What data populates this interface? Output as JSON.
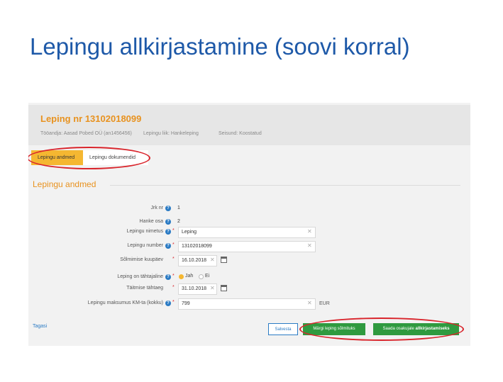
{
  "slide": {
    "title": "Lepingu allkirjastamine (soovi korral)"
  },
  "header": {
    "contract_title": "Leping nr 13102018099",
    "employer": "Tööandja: Aasad Pobed OÜ (an1456456)",
    "contract_type": "Lepingu liik: Hankeleping",
    "status": "Seisund: Koostatud"
  },
  "tabs": [
    {
      "label": "Lepingu andmed",
      "active": true
    },
    {
      "label": "Lepingu dokumendid",
      "active": false
    }
  ],
  "section": {
    "title": "Lepingu andmed"
  },
  "fields": {
    "seq_no": {
      "label": "Jrk nr",
      "value": "1"
    },
    "tender_part": {
      "label": "Hanke osa",
      "value": "2"
    },
    "contract_name": {
      "label": "Lepingu nimetus",
      "value": "Leping"
    },
    "contract_number": {
      "label": "Lepingu number",
      "value": "13102018099"
    },
    "conclusion_date": {
      "label": "Sõlmimise kuupäev",
      "value": "16.10.2018"
    },
    "fixed_term": {
      "label": "Leping on tähtajaline",
      "options": [
        "Jah",
        "Ei"
      ],
      "selected": "Jah"
    },
    "due_date": {
      "label": "Täitmise tähtaeg",
      "value": "31.10.2018"
    },
    "total_price": {
      "label": "Lepingu maksumus KM-ta (kokku)",
      "value": "799",
      "currency": "EUR"
    }
  },
  "footer": {
    "back_label": "Tagasi",
    "save_label": "Salvesta",
    "sign_label": "Märgi leping sõlmituks",
    "send_prefix": "Saada osakujale ",
    "send_bold": "allkirjastamiseks"
  },
  "colors": {
    "title_blue": "#1e59a8",
    "accent_orange": "#e8921f",
    "tab_yellow": "#f5b731",
    "button_green": "#2f9a3f",
    "highlight_red": "#d9252c",
    "link_blue": "#2b7bc4"
  },
  "icons": {
    "help": "question-circle-icon",
    "clear": "close-icon",
    "calendar": "calendar-icon"
  }
}
